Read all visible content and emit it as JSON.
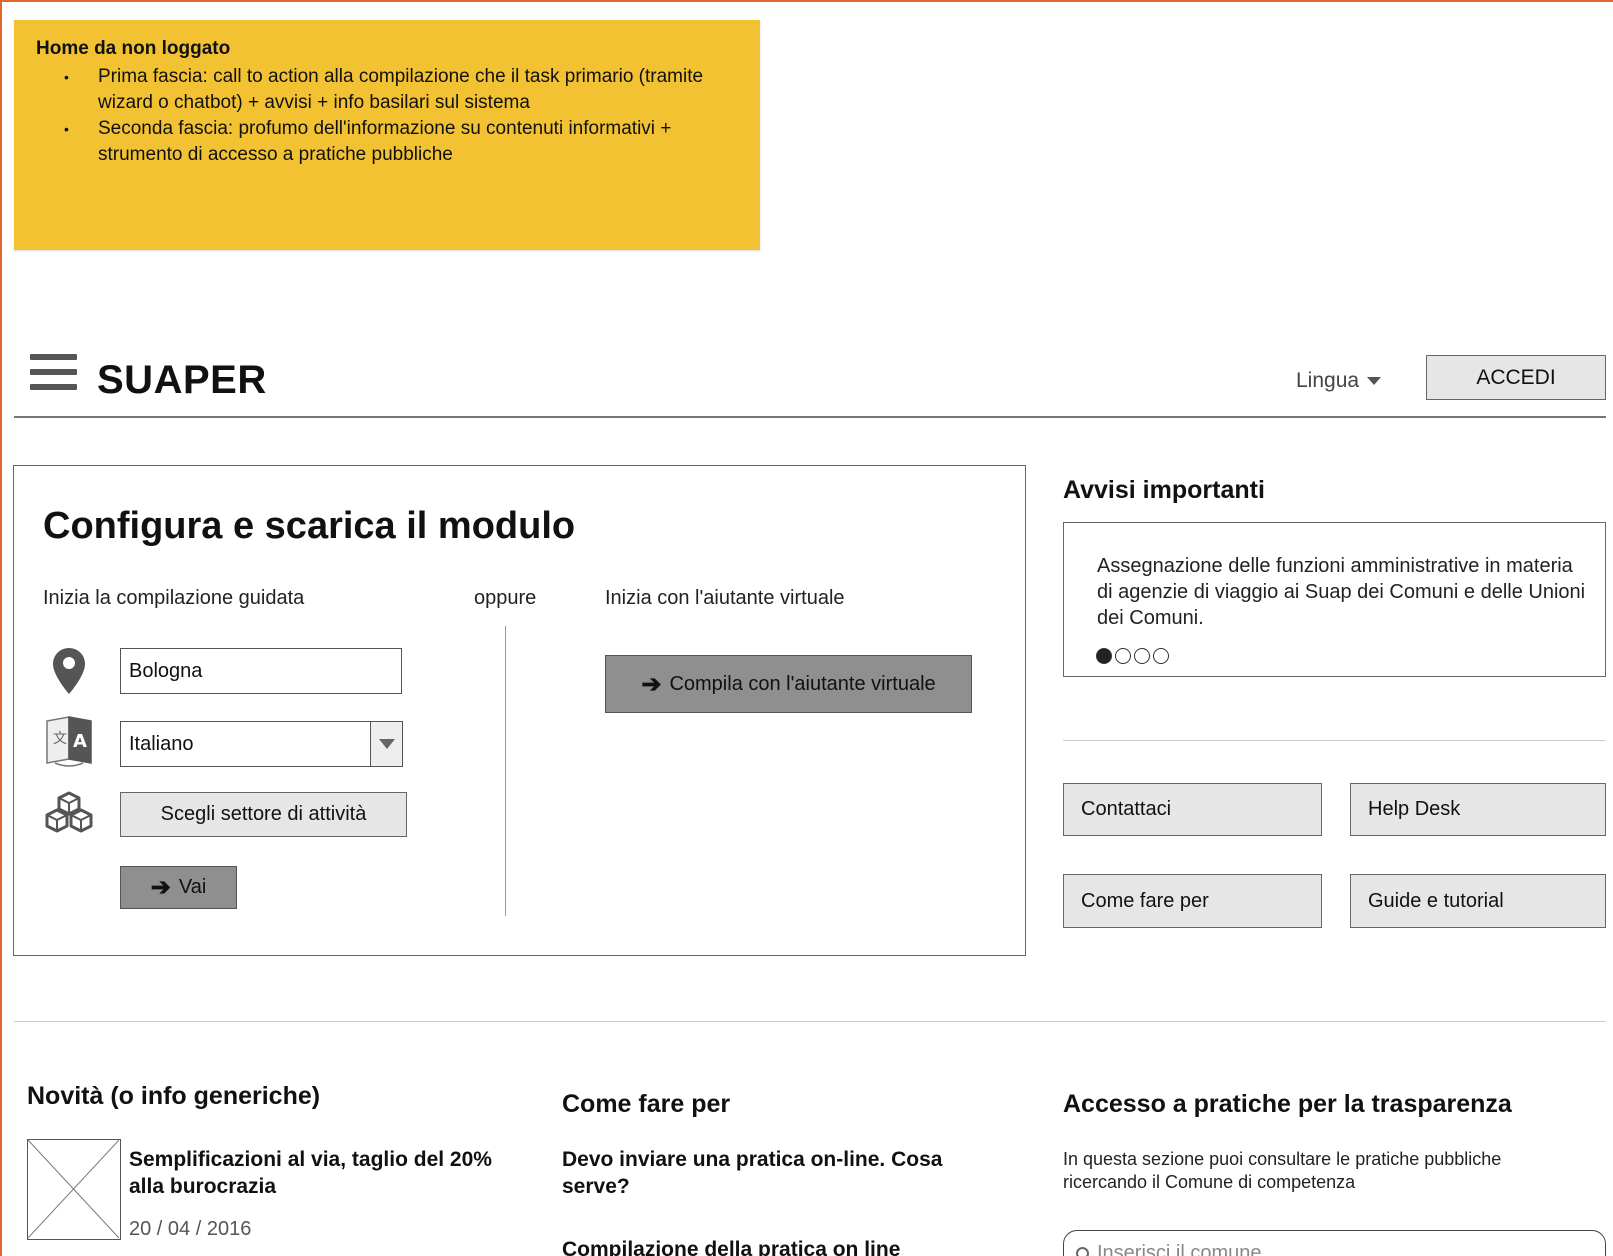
{
  "note": {
    "title": "Home da non loggato",
    "items": [
      "Prima fascia: call to action alla compilazione che il task primario (tramite wizard o chatbot) + avvisi + info basilari sul sistema",
      "Seconda fascia: profumo dell'informazione su contenuti informativi + strumento di accesso a pratiche pubbliche"
    ]
  },
  "header": {
    "brand": "SUAPER",
    "lingua_label": "Lingua",
    "login_label": "ACCEDI"
  },
  "config": {
    "title": "Configura e scarica il modulo",
    "guided_label": "Inizia la compilazione guidata",
    "or_label": "oppure",
    "virtual_label": "Inizia con l'aiutante virtuale",
    "city_value": "Bologna",
    "language_value": "Italiano",
    "sector_button": "Scegli settore di attività",
    "go_button": "Vai",
    "virtual_button": "Compila con l'aiutante virtuale"
  },
  "avvisi": {
    "title": "Avvisi importanti",
    "text": "Assegnazione delle funzioni amministrative in materia di agenzie di viaggio ai Suap dei Comuni e delle Unioni dei Comuni.",
    "active_slide": 1,
    "slide_count": 4
  },
  "quicklinks": {
    "contact": "Contattaci",
    "helpdesk": "Help Desk",
    "howto": "Come fare per",
    "guides": "Guide e tutorial"
  },
  "news": {
    "title": "Novità (o info generiche)",
    "item_title": "Semplificazioni al via, taglio del 20% alla burocrazia",
    "item_date": "20 / 04 / 2016"
  },
  "howto": {
    "title": "Come fare per",
    "q1": "Devo inviare una pratica on-line. Cosa serve?",
    "q2": "Compilazione della pratica on line"
  },
  "trasparenza": {
    "title": "Accesso a pratiche per la trasparenza",
    "text": "In questa sezione puoi consultare le pratiche pubbliche ricercando il Comune di competenza",
    "search_placeholder": "Inserisci il comune"
  }
}
